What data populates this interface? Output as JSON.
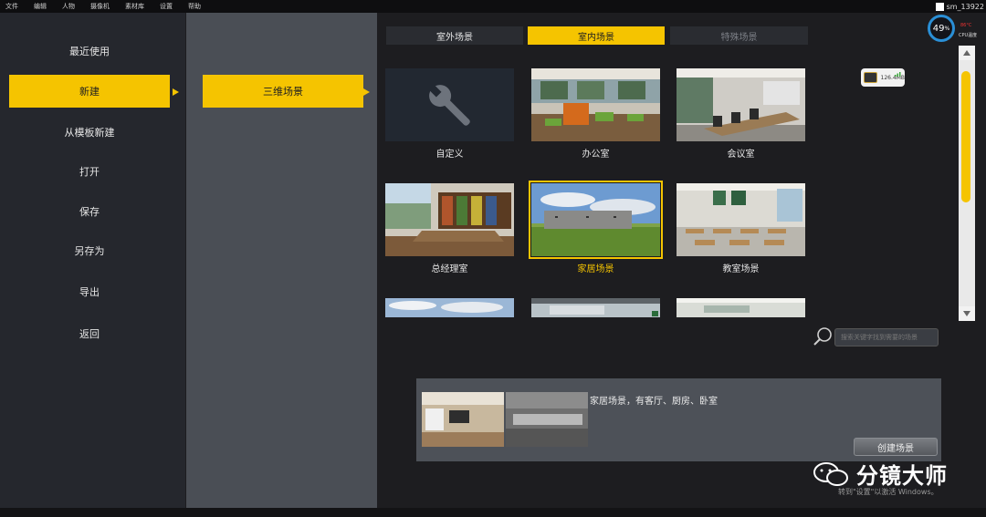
{
  "menubar": {
    "items": [
      "文件",
      "编辑",
      "人物",
      "摄像机",
      "素材库",
      "设置",
      "帮助"
    ],
    "user": "sm_13922"
  },
  "left_menu": {
    "items": [
      "最近使用",
      "新建",
      "从模板新建",
      "打开",
      "保存",
      "另存为",
      "导出",
      "返回"
    ],
    "active": "新建"
  },
  "sub_menu": {
    "items": [
      "三维场景"
    ]
  },
  "tabs": [
    {
      "label": "室外场景",
      "state": "normal"
    },
    {
      "label": "室内场景",
      "state": "active"
    },
    {
      "label": "特殊场景",
      "state": "disabled"
    }
  ],
  "scenes": [
    {
      "label": "自定义",
      "icon": "wrench-icon"
    },
    {
      "label": "办公室"
    },
    {
      "label": "会议室"
    },
    {
      "label": "总经理室"
    },
    {
      "label": "家居场景",
      "selected": true
    },
    {
      "label": "教室场景"
    }
  ],
  "search": {
    "placeholder": "搜索关键字找到需要的场景"
  },
  "description": {
    "text": "家居场景，有客厅、厨房、卧室",
    "create_button": "创建场景"
  },
  "hud": {
    "cpu_percent": "49",
    "cpu_percent_unit": "%",
    "cpu_temp": "86°C",
    "cpu_label": "CPU温度",
    "memory": "126.4MB"
  },
  "watermark": {
    "brand": "分镜大师",
    "activate_note": "转到\"设置\"以激活 Windows。"
  },
  "colors": {
    "accent": "#f5c400",
    "left_panel": "#25272d",
    "mid_panel": "#4a4e55"
  }
}
